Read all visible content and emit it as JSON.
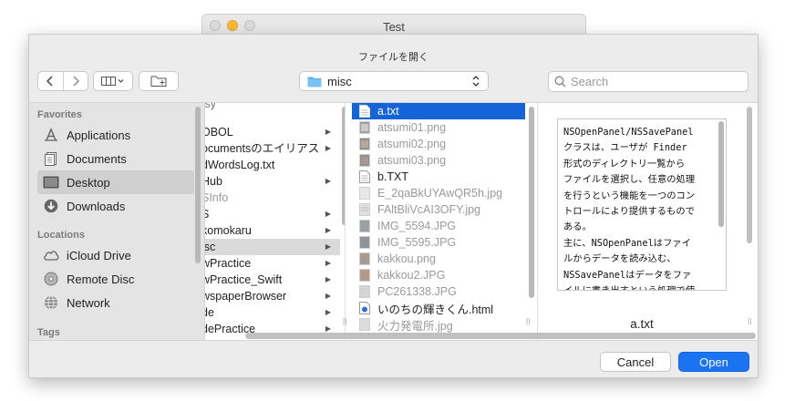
{
  "window": {
    "title": "Test"
  },
  "dialog": {
    "title": "ファイルを開く",
    "path": "misc",
    "search": {
      "placeholder": "Search",
      "value": ""
    }
  },
  "sidebar": {
    "favorites_header": "Favorites",
    "favorites": [
      {
        "label": "Applications",
        "icon": "applications-icon"
      },
      {
        "label": "Documents",
        "icon": "documents-icon"
      },
      {
        "label": "Desktop",
        "icon": "desktop-icon"
      },
      {
        "label": "Downloads",
        "icon": "downloads-icon"
      }
    ],
    "locations_header": "Locations",
    "locations": [
      {
        "label": "iCloud Drive",
        "icon": "icloud-icon"
      },
      {
        "label": "Remote Disc",
        "icon": "disc-icon"
      },
      {
        "label": "Network",
        "icon": "network-icon"
      }
    ],
    "tags_header": "Tags",
    "selected": "Desktop"
  },
  "column1": {
    "items": [
      {
        "label": "OBOL",
        "folder": true
      },
      {
        "label": "ocumentsのエイリアス",
        "folder": true
      },
      {
        "label": "dWordsLog.txt",
        "folder": false
      },
      {
        "label": "Hub",
        "folder": true
      },
      {
        "label": "SInfo",
        "folder": false,
        "dim": true
      },
      {
        "label": "S",
        "folder": true
      },
      {
        "label": "komokaru",
        "folder": true
      },
      {
        "label": "isc",
        "folder": true,
        "selected": true
      },
      {
        "label": "wPractice",
        "folder": true
      },
      {
        "label": "wPractice_Swift",
        "folder": true
      },
      {
        "label": "wspaperBrowser",
        "folder": true
      },
      {
        "label": "de",
        "folder": true
      },
      {
        "label": "dePractice",
        "folder": true
      }
    ]
  },
  "column2": {
    "items": [
      {
        "label": "a.txt",
        "type": "text",
        "selected": true
      },
      {
        "label": "atsumi01.png",
        "type": "image",
        "dim": true
      },
      {
        "label": "atsumi02.png",
        "type": "image",
        "dim": true
      },
      {
        "label": "atsumi03.png",
        "type": "image",
        "dim": true
      },
      {
        "label": "b.TXT",
        "type": "text"
      },
      {
        "label": "E_2qaBkUYAwQR5h.jpg",
        "type": "image",
        "dim": true
      },
      {
        "label": "FAltBliVcAI3OFY.jpg",
        "type": "image",
        "dim": true
      },
      {
        "label": "IMG_5594.JPG",
        "type": "image",
        "dim": true
      },
      {
        "label": "IMG_5595.JPG",
        "type": "image",
        "dim": true
      },
      {
        "label": "kakkou.png",
        "type": "image",
        "dim": true
      },
      {
        "label": "kakkou2.JPG",
        "type": "image",
        "dim": true
      },
      {
        "label": "PC261338.JPG",
        "type": "image",
        "dim": true
      },
      {
        "label": "いのちの輝きくん.html",
        "type": "html"
      },
      {
        "label": "火力発電所.jpg",
        "type": "image",
        "dim": true
      }
    ]
  },
  "preview": {
    "filename": "a.txt",
    "text": "NSOpenPanel/NSSavePanel\nクラスは、ユーザが Finder\n形式のディレクトリ一覧から\nファイルを選択し、任意の処理\nを行うという機能を一つのコン\nトロールにより提供するもので\nある。\n主に、NSOpenPanelはファイ\nルからデータを読み込む、\nNSSavePanelはデータをファ\nイルに書き出すという処理で使\nわれる。"
  },
  "buttons": {
    "cancel": "Cancel",
    "open": "Open"
  }
}
